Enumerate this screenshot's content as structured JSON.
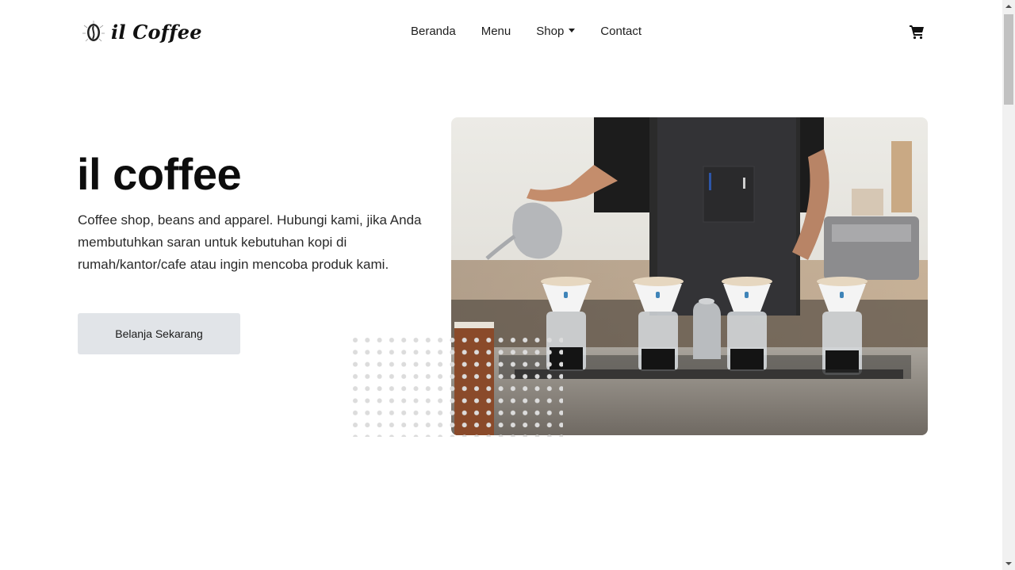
{
  "brand": {
    "name": "il Coffee",
    "logo_icon": "coffee-bean-logo-icon"
  },
  "nav": {
    "items": [
      {
        "label": "Beranda"
      },
      {
        "label": "Menu"
      },
      {
        "label": "Shop",
        "has_dropdown": true
      },
      {
        "label": "Contact"
      }
    ],
    "cart_icon": "shopping-cart-icon"
  },
  "hero": {
    "title": "il coffee",
    "description": "Coffee shop, beans and apparel. Hubungi kami, jika Anda membutuhkan saran untuk kebutuhan kopi di rumah/kantor/cafe atau ingin mencoba produk kami.",
    "cta_label": "Belanja Sekarang",
    "image_subject": "barista pouring over coffee drippers"
  },
  "colors": {
    "button_bg": "#e1e4e8",
    "text": "#0d0d0d",
    "background": "#ffffff"
  }
}
